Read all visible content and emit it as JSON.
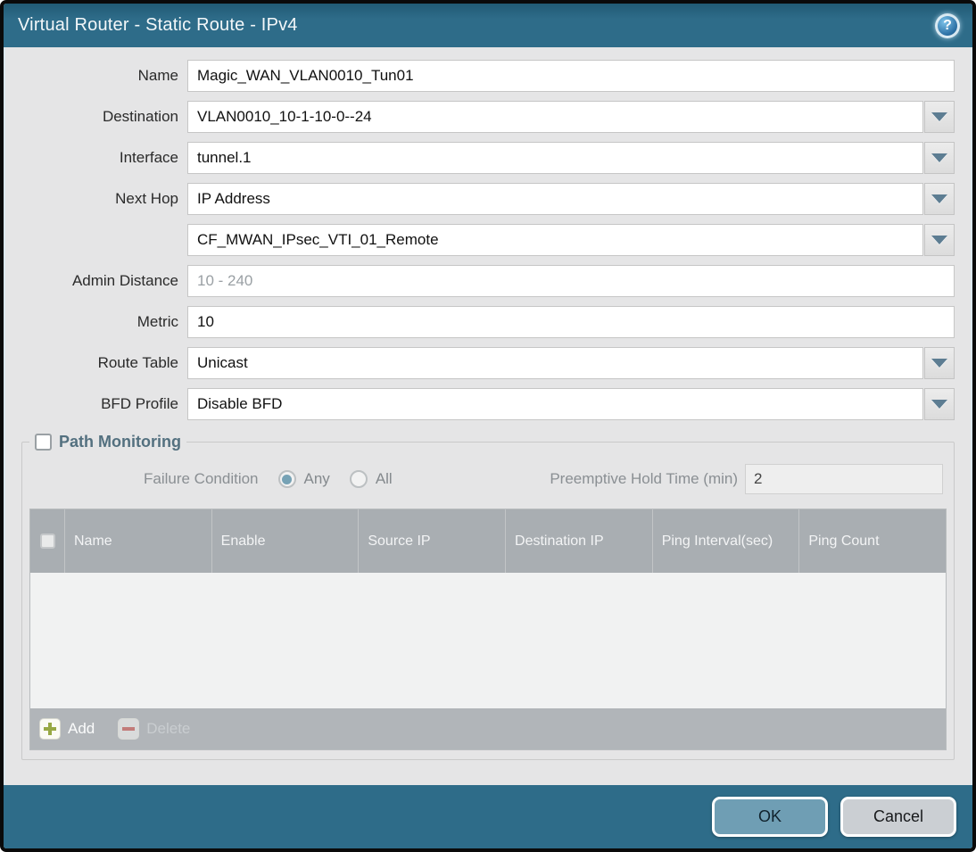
{
  "dialog": {
    "title": "Virtual Router - Static Route - IPv4",
    "help_icon": "?"
  },
  "form": {
    "name": {
      "label": "Name",
      "value": "Magic_WAN_VLAN0010_Tun01"
    },
    "destination": {
      "label": "Destination",
      "value": "VLAN0010_10-1-10-0--24"
    },
    "interface": {
      "label": "Interface",
      "value": "tunnel.1"
    },
    "next_hop": {
      "label": "Next Hop",
      "value": "IP Address"
    },
    "next_hop_address": {
      "value": "CF_MWAN_IPsec_VTI_01_Remote"
    },
    "admin_distance": {
      "label": "Admin Distance",
      "placeholder": "10 - 240",
      "value": ""
    },
    "metric": {
      "label": "Metric",
      "value": "10"
    },
    "route_table": {
      "label": "Route Table",
      "value": "Unicast"
    },
    "bfd_profile": {
      "label": "BFD Profile",
      "value": "Disable BFD"
    }
  },
  "path_monitoring": {
    "title": "Path Monitoring",
    "enabled": false,
    "failure_condition": {
      "label": "Failure Condition",
      "options": [
        "Any",
        "All"
      ],
      "selected": "Any"
    },
    "preemptive_hold_time": {
      "label": "Preemptive Hold Time (min)",
      "value": "2"
    },
    "table": {
      "columns": [
        "Name",
        "Enable",
        "Source IP",
        "Destination IP",
        "Ping Interval(sec)",
        "Ping Count"
      ],
      "rows": []
    },
    "add_label": "Add",
    "delete_label": "Delete"
  },
  "footer": {
    "ok_label": "OK",
    "cancel_label": "Cancel"
  },
  "colors": {
    "titlebar": "#2e6c89",
    "body": "#e5e5e6",
    "table_header": "#a9aeb2",
    "ok_button": "#6f9eb4",
    "cancel_button": "#cbcfd3",
    "accent_radio": "#76a2b5",
    "add_plus": "#97a844",
    "delete_minus": "#c27c7a"
  }
}
